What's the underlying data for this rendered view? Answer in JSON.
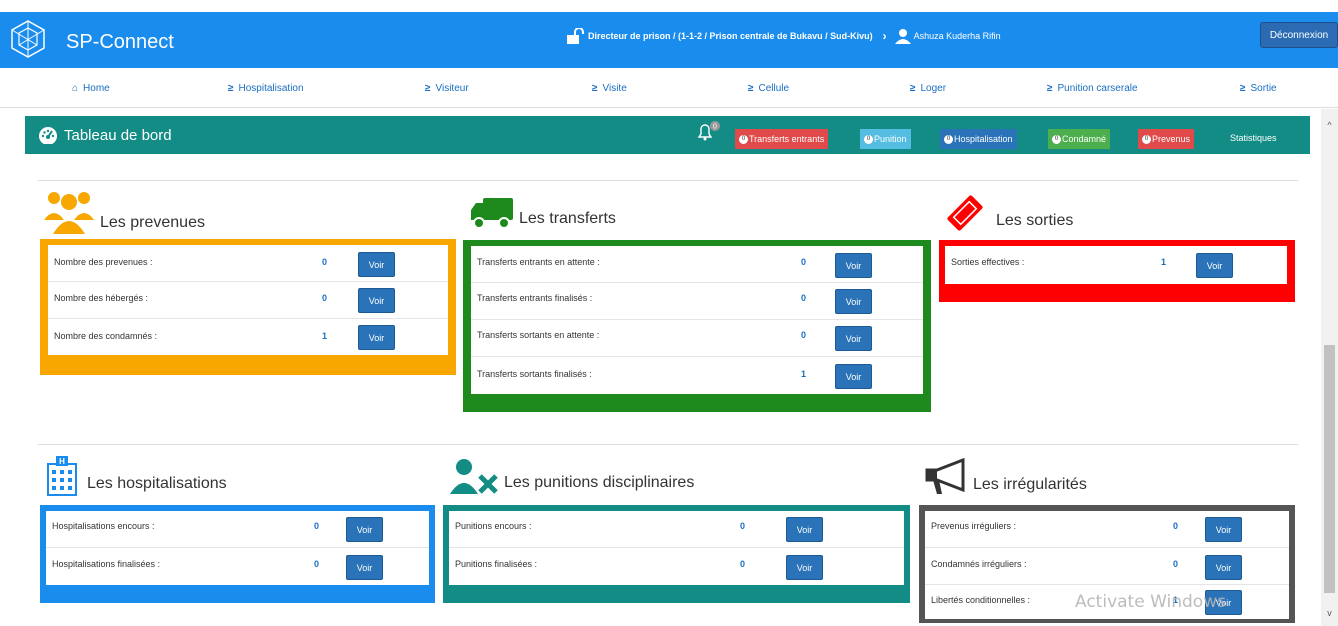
{
  "header": {
    "brand": "SP-Connect",
    "role": "Directeur de prison / (1-1-2 / Prison centrale de Bukavu / Sud-Kivu)",
    "chevron": "›",
    "user": "Ashuza Kuderha Rifin",
    "logout": "Déconnexion"
  },
  "nav": {
    "home": "Home",
    "hospitalisation": "Hospitalisation",
    "visiteur": "Visiteur",
    "visite": "Visite",
    "cellule": "Cellule",
    "loger": "Loger",
    "punition": "Punition carserale",
    "sortie": "Sortie"
  },
  "dashboard": {
    "title": "Tableau de bord",
    "bell_count": "0",
    "pills": {
      "transferts": {
        "count": "0",
        "label": "Transferts entrants",
        "color": "#e04a4a"
      },
      "punition": {
        "count": "0",
        "label": "Punition",
        "color": "#55bde2"
      },
      "hospitalisation": {
        "count": "0",
        "label": "Hospitalisation",
        "color": "#2a73b8"
      },
      "condamne": {
        "count": "0",
        "label": "Condamné",
        "color": "#4cae4c"
      },
      "prevenus": {
        "count": "0",
        "label": "Prevenus",
        "color": "#e04a4a"
      }
    },
    "statistiques": "Statistiques"
  },
  "voir_label": "Voir",
  "sections": {
    "prevenues": {
      "title": "Les prevenues",
      "color": "#f7a700",
      "rows": [
        {
          "label": "Nombre des prevenues :",
          "value": "0"
        },
        {
          "label": "Nombre des hébergés :",
          "value": "0"
        },
        {
          "label": "Nombre des condamnés :",
          "value": "1"
        }
      ]
    },
    "transferts": {
      "title": "Les transferts",
      "color": "#1e8a1e",
      "rows": [
        {
          "label": "Transferts entrants en attente :",
          "value": "0"
        },
        {
          "label": "Transferts entrants finalisés :",
          "value": "0"
        },
        {
          "label": "Transferts sortants en attente :",
          "value": "0"
        },
        {
          "label": "Transferts sortants finalisés :",
          "value": "1"
        }
      ]
    },
    "sorties": {
      "title": "Les sorties",
      "color": "#ff0000",
      "rows": [
        {
          "label": "Sorties effectives :",
          "value": "1"
        }
      ]
    },
    "hospitalisations": {
      "title": "Les hospitalisations",
      "color": "#1a8ced",
      "rows": [
        {
          "label": "Hospitalisations encours :",
          "value": "0"
        },
        {
          "label": "Hospitalisations finalisées :",
          "value": "0"
        }
      ]
    },
    "punitions": {
      "title": "Les punitions disciplinaires",
      "color": "#128c85",
      "rows": [
        {
          "label": "Punitions encours :",
          "value": "0"
        },
        {
          "label": "Punitions finalisées :",
          "value": "0"
        }
      ]
    },
    "irregularites": {
      "title": "Les irrégularités",
      "color": "#555555",
      "rows": [
        {
          "label": "Prevenus irréguliers :",
          "value": "0"
        },
        {
          "label": "Condamnés irréguliers :",
          "value": "0"
        },
        {
          "label": "Libertés conditionnelles :",
          "value": "1"
        }
      ]
    }
  },
  "watermark": "Activate Windows"
}
